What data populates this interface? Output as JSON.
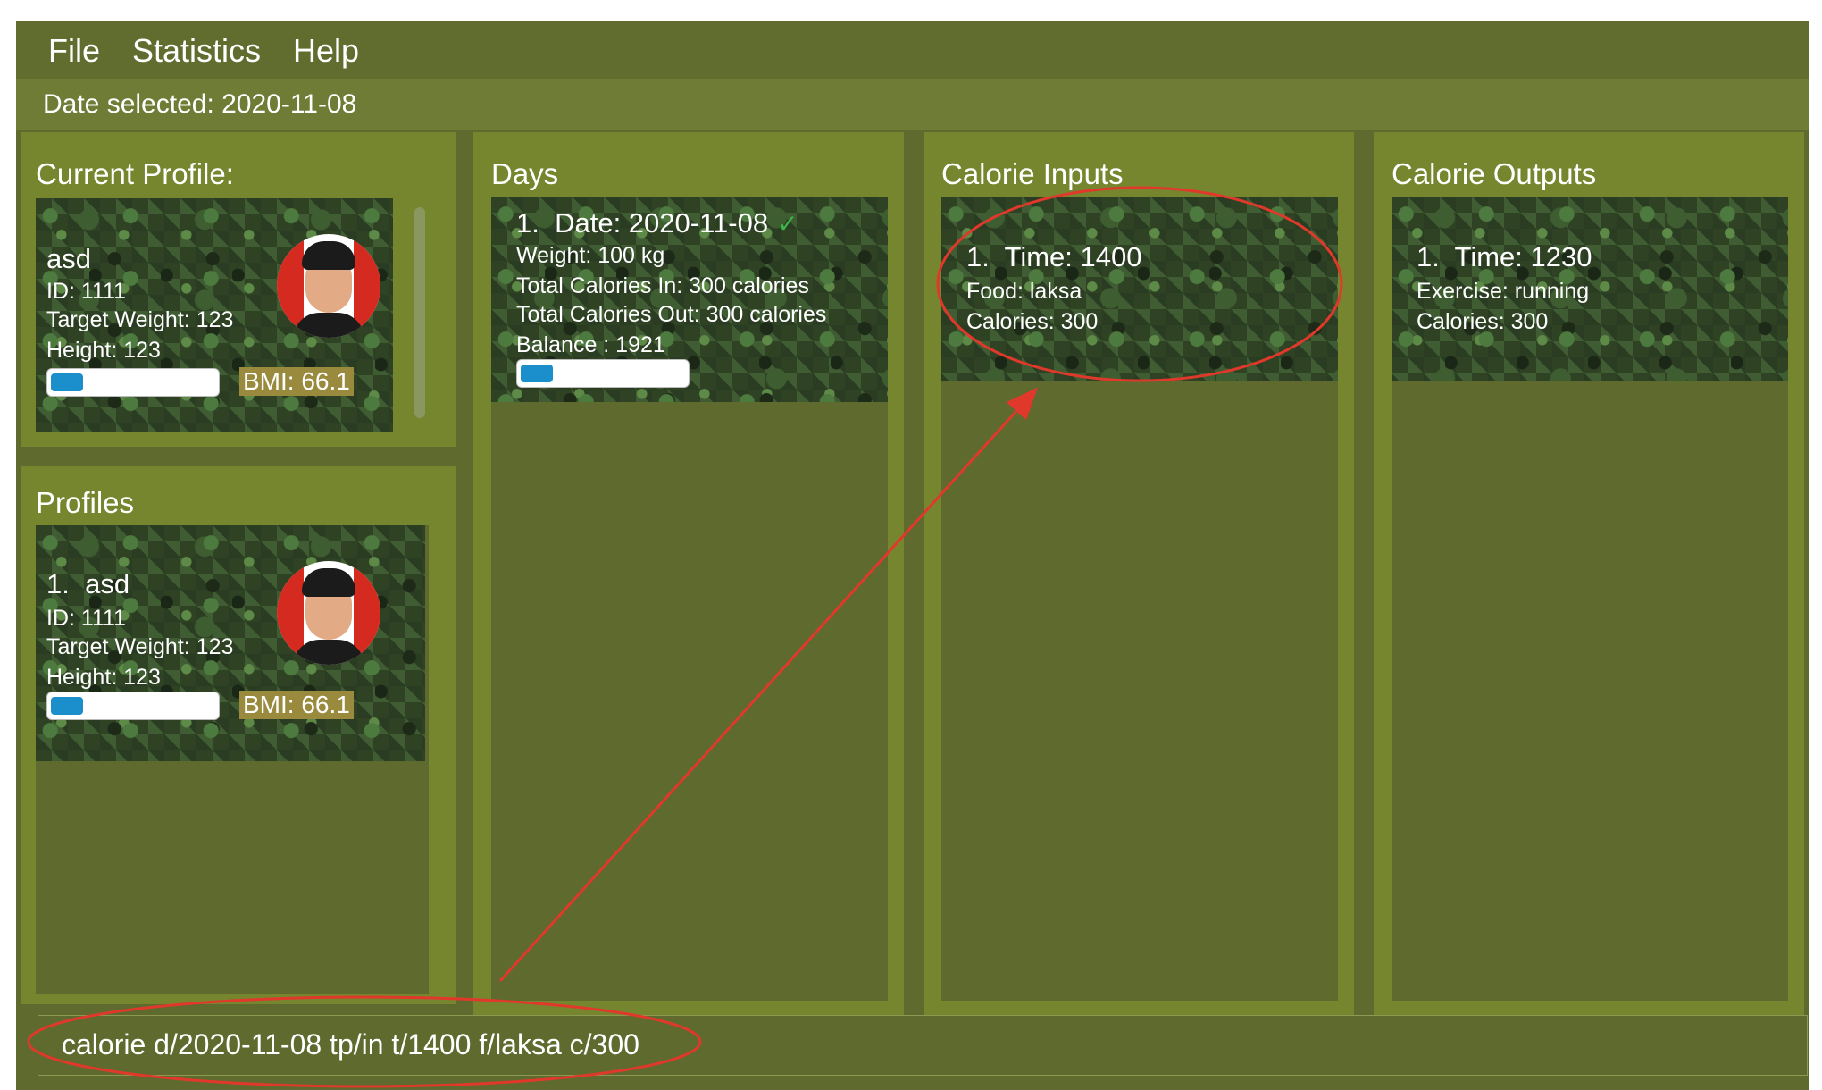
{
  "menu": {
    "items": [
      "File",
      "Statistics",
      "Help"
    ]
  },
  "date_selected": "Date selected: 2020-11-08",
  "current_profile": {
    "title": "Current Profile:",
    "name": "asd",
    "id": "ID: 1111",
    "target_weight": "Target Weight: 123",
    "height": "Height: 123",
    "bmi": "BMI: 66.1",
    "bmi_progress": 0.18
  },
  "profiles": {
    "title": "Profiles",
    "items": [
      {
        "index": "1.",
        "name": "asd",
        "id": "ID: 1111",
        "target_weight": "Target Weight: 123",
        "height": "Height: 123",
        "bmi": "BMI: 66.1",
        "bmi_progress": 0.18
      }
    ]
  },
  "days": {
    "title": "Days",
    "items": [
      {
        "index": "1.",
        "date": "Date: 2020-11-08",
        "check": "✓",
        "weight": "Weight: 100 kg",
        "calories_in": "Total Calories In: 300 calories",
        "calories_out": "Total Calories Out: 300 calories",
        "balance": "Balance : 1921",
        "progress": 0.18
      }
    ]
  },
  "calorie_inputs": {
    "title": "Calorie Inputs",
    "items": [
      {
        "index": "1.",
        "time": "Time: 1400",
        "food": "Food: laksa",
        "calories": "Calories: 300"
      }
    ]
  },
  "calorie_outputs": {
    "title": "Calorie Outputs",
    "items": [
      {
        "index": "1.",
        "time": "Time: 1230",
        "exercise": "Exercise: running",
        "calories": "Calories: 300"
      }
    ]
  },
  "command": {
    "value": "calorie d/2020-11-08 tp/in t/1400 f/laksa c/300"
  },
  "colors": {
    "window_bg": "#5e6a2e",
    "panel_bg": "#76862f",
    "annotation": "#e0392b",
    "progress_fill": "#1a8fcb",
    "bmi_badge": "#9a8a3e"
  }
}
